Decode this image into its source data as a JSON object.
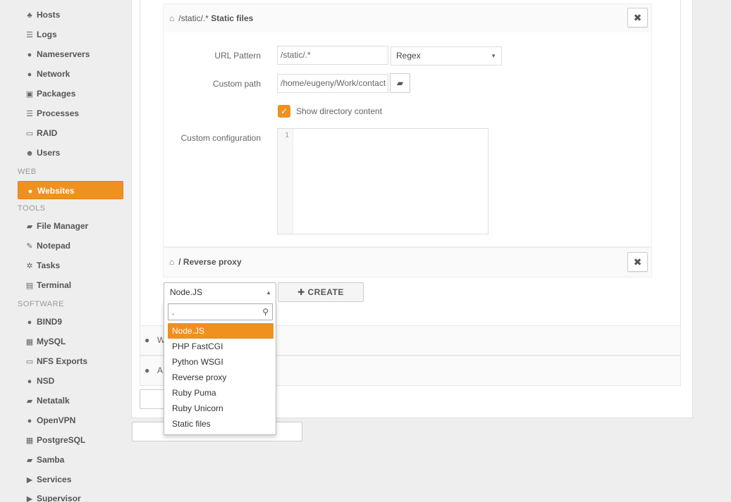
{
  "sidebar": {
    "items": [
      {
        "label": "Hosts",
        "icon": "sitemap-icon",
        "glyph": "♣"
      },
      {
        "label": "Logs",
        "icon": "list-icon",
        "glyph": "☰"
      },
      {
        "label": "Nameservers",
        "icon": "globe-icon",
        "glyph": "●"
      },
      {
        "label": "Network",
        "icon": "globe-icon",
        "glyph": "●"
      },
      {
        "label": "Packages",
        "icon": "gift-icon",
        "glyph": "▣"
      },
      {
        "label": "Processes",
        "icon": "list-icon",
        "glyph": "☰"
      },
      {
        "label": "RAID",
        "icon": "hdd-icon",
        "glyph": "▭"
      },
      {
        "label": "Users",
        "icon": "users-icon",
        "glyph": "☻"
      }
    ],
    "section_web": "WEB",
    "websites": {
      "label": "Websites",
      "icon": "globe-icon",
      "glyph": "●"
    },
    "section_tools": "TOOLS",
    "tools": [
      {
        "label": "File Manager",
        "icon": "folder-open-icon",
        "glyph": "▰"
      },
      {
        "label": "Notepad",
        "icon": "edit-icon",
        "glyph": "✎"
      },
      {
        "label": "Tasks",
        "icon": "cog-icon",
        "glyph": "✲"
      },
      {
        "label": "Terminal",
        "icon": "terminal-icon",
        "glyph": "▤"
      }
    ],
    "section_software": "SOFTWARE",
    "software": [
      {
        "label": "BIND9",
        "icon": "globe-icon",
        "glyph": "●"
      },
      {
        "label": "MySQL",
        "icon": "table-icon",
        "glyph": "▦"
      },
      {
        "label": "NFS Exports",
        "icon": "hdd-icon",
        "glyph": "▭"
      },
      {
        "label": "NSD",
        "icon": "globe-icon",
        "glyph": "●"
      },
      {
        "label": "Netatalk",
        "icon": "folder-icon",
        "glyph": "▰"
      },
      {
        "label": "OpenVPN",
        "icon": "globe-icon",
        "glyph": "●"
      },
      {
        "label": "PostgreSQL",
        "icon": "table-icon",
        "glyph": "▦"
      },
      {
        "label": "Samba",
        "icon": "folder-icon",
        "glyph": "▰"
      },
      {
        "label": "Services",
        "icon": "play-icon",
        "glyph": "▶"
      },
      {
        "label": "Supervisor",
        "icon": "play-icon",
        "glyph": "▶"
      }
    ]
  },
  "static_location": {
    "path_prefix": "/static/.*",
    "type_label": "Static files",
    "url_pattern_label": "URL Pattern",
    "url_pattern_value": "/static/.*",
    "match_type": "Regex",
    "custom_path_label": "Custom path",
    "custom_path_value": "/home/eugeny/Work/contact",
    "show_dir_label": "Show directory content",
    "show_dir_checked": true,
    "custom_config_label": "Custom configuration",
    "editor_line": "1"
  },
  "proxy_location": {
    "path": "/ Reverse proxy"
  },
  "new_location": {
    "selected": "Node.JS",
    "create_label": "CREATE",
    "search_value": ".",
    "options": [
      "Node.JS",
      "PHP FastCGI",
      "Python WSGI",
      "Reverse proxy",
      "Ruby Puma",
      "Ruby Unicorn",
      "Static files"
    ]
  },
  "rows": {
    "row1_text": "W",
    "row2_text": "A"
  },
  "colors": {
    "accent": "#f0901f"
  }
}
